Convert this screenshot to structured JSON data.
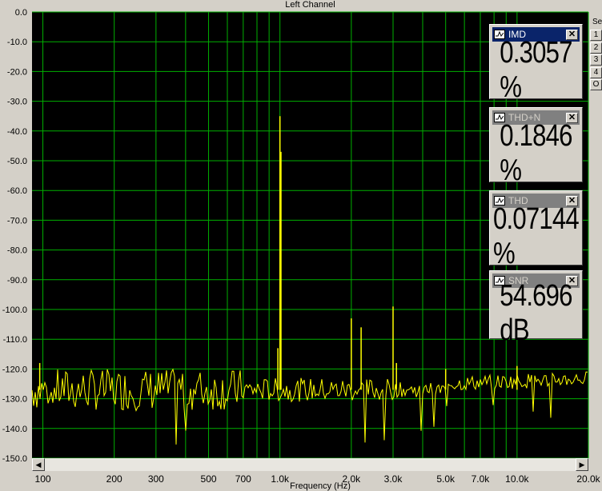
{
  "window": {
    "title": "Left Channel",
    "side_label": "Se",
    "side_buttons": [
      "1",
      "2",
      "3",
      "4",
      "O"
    ],
    "x_axis_title": "Frequency (Hz)"
  },
  "panels": [
    {
      "name": "IMD",
      "value": "0.3057 %",
      "active": true
    },
    {
      "name": "THD+N",
      "value": "0.1846 %",
      "active": false
    },
    {
      "name": "THD",
      "value": "0.07144 %",
      "active": false
    },
    {
      "name": "SNR",
      "value": "54.696 dB",
      "active": false
    }
  ],
  "colors": {
    "background": "#000000",
    "grid": "#00b000",
    "trace": "#ffff00",
    "chrome": "#d4d0c8"
  },
  "chart_data": {
    "type": "line",
    "title": "Left Channel",
    "xlabel": "Frequency (Hz)",
    "ylabel": "",
    "x_scale": "log",
    "xlim": [
      90,
      20000
    ],
    "ylim": [
      -150,
      0
    ],
    "y_ticks": [
      "0.0",
      "-10.0",
      "-20.0",
      "-30.0",
      "-40.0",
      "-50.0",
      "-60.0",
      "-70.0",
      "-80.0",
      "-90.0",
      "-100.0",
      "-110.0",
      "-120.0",
      "-130.0",
      "-140.0",
      "-150.0"
    ],
    "x_ticks": [
      {
        "value": 100,
        "label": "100"
      },
      {
        "value": 200,
        "label": "200"
      },
      {
        "value": 300,
        "label": "300"
      },
      {
        "value": 500,
        "label": "500"
      },
      {
        "value": 700,
        "label": "700"
      },
      {
        "value": 1000,
        "label": "1.0k"
      },
      {
        "value": 2000,
        "label": "2.0k"
      },
      {
        "value": 3000,
        "label": "3.0k"
      },
      {
        "value": 5000,
        "label": "5.0k"
      },
      {
        "value": 7000,
        "label": "7.0k"
      },
      {
        "value": 10000,
        "label": "10.0k"
      },
      {
        "value": 20000,
        "label": "20.0k"
      }
    ],
    "grid": true,
    "series": [
      {
        "noise_floor_db": -127,
        "peaks": [
          {
            "x": 97,
            "y": -118
          },
          {
            "x": 1000,
            "y": -35
          },
          {
            "x": 1010,
            "y": -47
          },
          {
            "x": 980,
            "y": -113
          },
          {
            "x": 2000,
            "y": -103
          },
          {
            "x": 2200,
            "y": -106
          },
          {
            "x": 3000,
            "y": -99
          },
          {
            "x": 3100,
            "y": -118
          },
          {
            "x": 5000,
            "y": -120
          },
          {
            "x": 10000,
            "y": -119
          }
        ]
      }
    ]
  }
}
